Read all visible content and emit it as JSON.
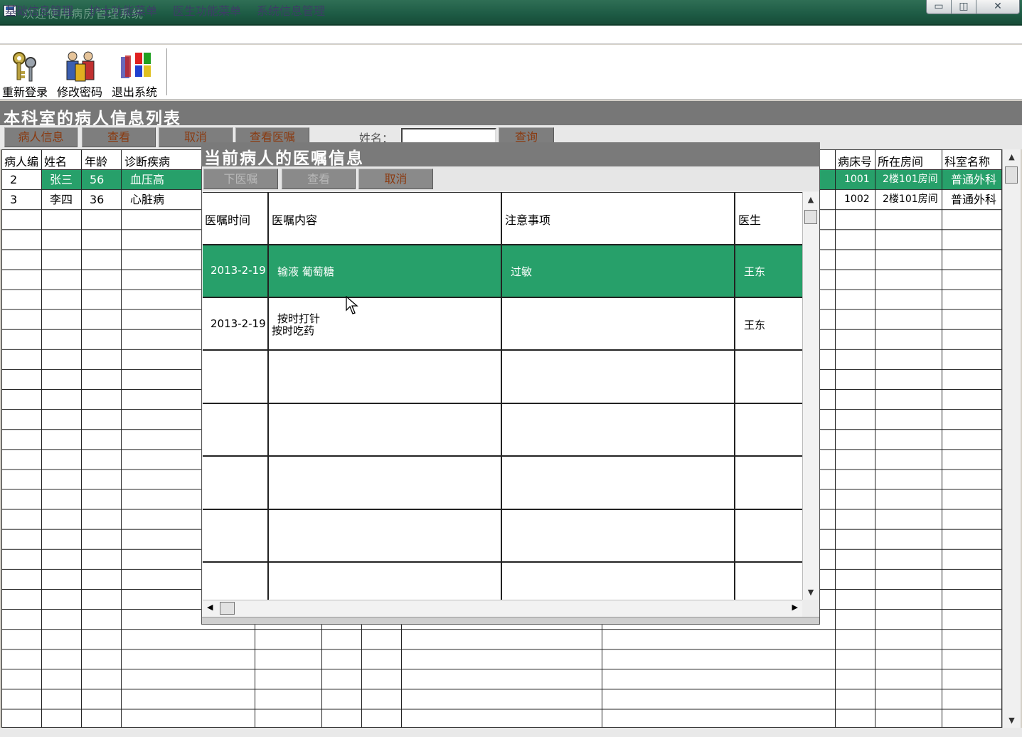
{
  "window": {
    "title": "欢迎使用病房管理系统",
    "controls": [
      "▭",
      "◫",
      "✕"
    ]
  },
  "menu": {
    "items": [
      "基础信息管理",
      "护士功能菜单",
      "医生功能菜单",
      "系统信息管理"
    ]
  },
  "toolbar": {
    "relogin": "重新登录",
    "change_password": "修改密码",
    "exit": "退出系统"
  },
  "section": {
    "title": "本科室的病人信息列表"
  },
  "main_actions": {
    "patient_info": "病人信息",
    "view": "查看",
    "cancel": "取消",
    "view_orders": "查看医嘱",
    "name_label": "姓名：",
    "name_value": "",
    "query": "查询"
  },
  "patients": {
    "columns": [
      "病人编",
      "姓名",
      "年龄",
      "诊断疾病",
      "病床号",
      "所在房间",
      "科室名称"
    ],
    "rows": [
      {
        "id": "2",
        "name": "张三",
        "age": "56",
        "diagnosis": "血压高",
        "bed": "1001",
        "room": "2楼101房间",
        "dept": "普通外科"
      },
      {
        "id": "3",
        "name": "李四",
        "age": "36",
        "diagnosis": "心脏病",
        "bed": "1002",
        "room": "2楼101房间",
        "dept": "普通外科"
      }
    ]
  },
  "dialog": {
    "title": "当前病人的医嘱信息",
    "actions": {
      "issue_order": "下医嘱",
      "view": "查看",
      "cancel": "取消"
    },
    "columns": [
      "医嘱时间",
      "医嘱内容",
      "注意事项",
      "医生"
    ],
    "rows": [
      {
        "time": "2013-2-19",
        "content": "输液  葡萄糖",
        "note": "过敏",
        "doctor": "王东"
      },
      {
        "time": "2013-2-19",
        "content_line1": "按时打针",
        "content_line2": "按时吃药",
        "note": "",
        "doctor": "王东"
      }
    ]
  },
  "colors": {
    "selection": "#27a06a",
    "header_gray": "#777777",
    "button_text": "#8a3a10",
    "titlebar": "#1d5a44"
  }
}
